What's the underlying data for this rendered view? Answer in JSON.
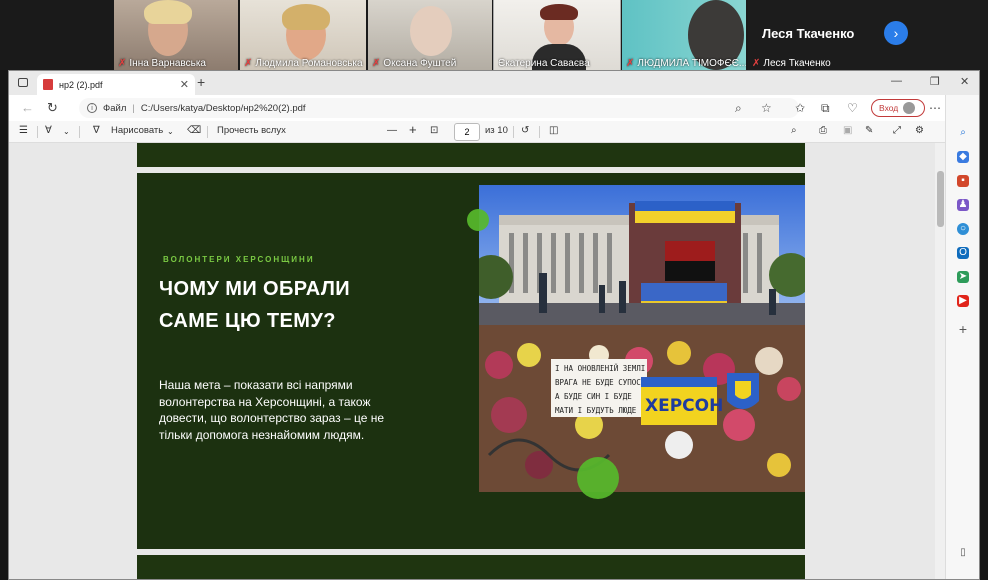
{
  "participants": [
    {
      "name": "Інна Варнавська"
    },
    {
      "name": "Людмила Романовська"
    },
    {
      "name": "Оксана Фуштей"
    },
    {
      "name": "Єкатерина Саваєва"
    },
    {
      "name": "ЛЮДМИЛА ТІМОФЄЄ..."
    }
  ],
  "speaker_panel": {
    "name": "Леся Ткаченко",
    "bottom_name": "Леся Ткаченко"
  },
  "browser": {
    "tab_title": "нр2 (2).pdf",
    "url_scheme": "Файл",
    "url_path": "C:/Users/katya/Desktop/нр2%20(2).pdf",
    "login_label": "Вход"
  },
  "pdf_toolbar": {
    "draw_label": "Нарисовать",
    "read_aloud_label": "Прочесть вслух",
    "page_current": "2",
    "page_total_label": "из 10"
  },
  "slide": {
    "kicker": "ВОЛОНТЕРИ ХЕРСОНЩИНИ",
    "title_line1": "ЧОМУ МИ ОБРАЛИ",
    "title_line2": "САМЕ ЦЮ ТЕМУ?",
    "body": "Наша мета – показати всі напрями волонтерства на Херсонщині, а також довести, що волонтерство зараз – це не тільки допомога незнайомим людям.",
    "photo": {
      "sign_lines": [
        "І НА ОНОВЛЕНІЙ ЗЕМЛІ",
        "ВРАГА НЕ БУДЕ СУПОСТАТА",
        "А БУДЕ СИН І БУДЕ",
        "МАТИ І БУДУТЬ ЛЮДЕ"
      ],
      "banner": "ХЕРСОН"
    }
  },
  "colors": {
    "slide_bg": "#1c3110",
    "accent_green": "#7ac943",
    "dot_green": "#57b82b"
  }
}
